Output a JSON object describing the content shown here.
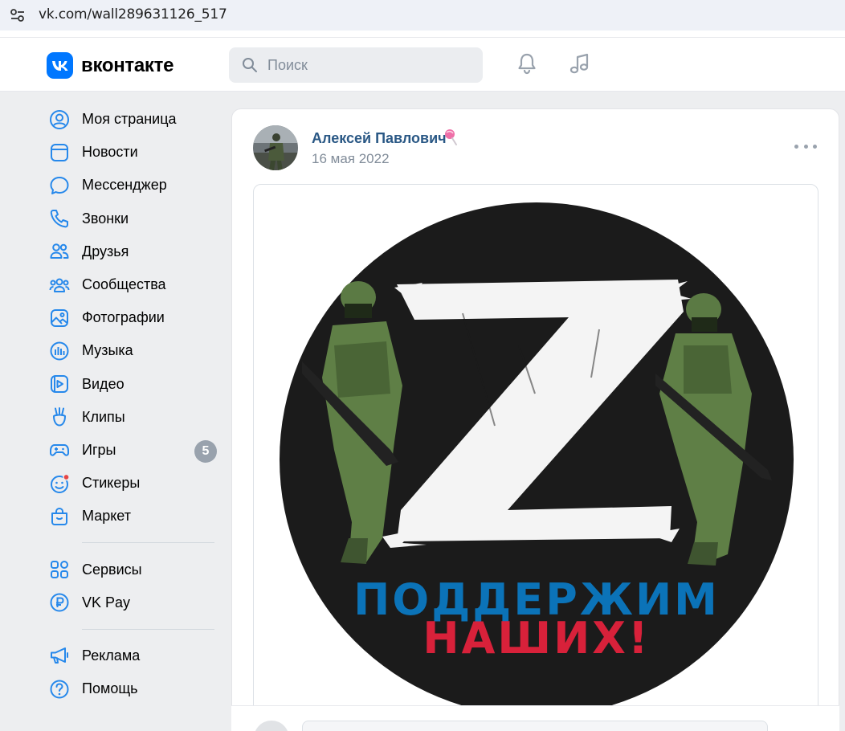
{
  "browser": {
    "url": "vk.com/wall289631126_517"
  },
  "header": {
    "logo_text": "вконтакте",
    "search_placeholder": "Поиск",
    "accent": "#0077ff"
  },
  "sidebar": {
    "items": [
      {
        "label": "Моя страница",
        "icon": "user-circle-icon"
      },
      {
        "label": "Новости",
        "icon": "news-icon"
      },
      {
        "label": "Мессенджер",
        "icon": "message-bubble-icon"
      },
      {
        "label": "Звонки",
        "icon": "phone-icon"
      },
      {
        "label": "Друзья",
        "icon": "friends-icon"
      },
      {
        "label": "Сообщества",
        "icon": "communities-icon"
      },
      {
        "label": "Фотографии",
        "icon": "photo-icon"
      },
      {
        "label": "Музыка",
        "icon": "music-bars-icon"
      },
      {
        "label": "Видео",
        "icon": "video-icon"
      },
      {
        "label": "Клипы",
        "icon": "clips-icon"
      },
      {
        "label": "Игры",
        "icon": "gamepad-icon",
        "badge": "5"
      },
      {
        "label": "Стикеры",
        "icon": "sticker-smile-icon"
      },
      {
        "label": "Маркет",
        "icon": "shopping-bag-icon"
      }
    ],
    "items2": [
      {
        "label": "Сервисы",
        "icon": "services-grid-icon"
      },
      {
        "label": "VK Pay",
        "icon": "vkpay-icon"
      }
    ],
    "items3": [
      {
        "label": "Реклама",
        "icon": "megaphone-icon"
      },
      {
        "label": "Помощь",
        "icon": "help-icon"
      }
    ]
  },
  "post": {
    "author": "Алексей Павлович",
    "date": "16 мая 2022",
    "image_caption_line1": "ПОДДЕРЖИМ",
    "image_caption_line2": "НАШИХ!",
    "image_letter": "Z",
    "caption_color1": "#0b73b8",
    "caption_color2": "#d8213a"
  }
}
